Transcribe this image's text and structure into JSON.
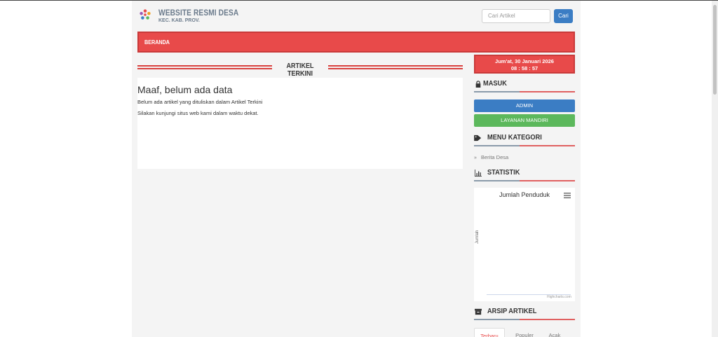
{
  "header": {
    "site_title": "WEBSITE RESMI DESA",
    "site_subtitle": "KEC. KAB. PROV.",
    "search_placeholder": "Cari Artikel",
    "search_button": "Cari"
  },
  "nav": {
    "items": [
      {
        "label": "BERANDA"
      }
    ]
  },
  "main": {
    "section_title": "ARTIKEL TERKINI",
    "nodata_title": "Maaf, belum ada data",
    "nodata_line1": "Belum ada artikel yang dituliskan dalam Artikel Terkini",
    "nodata_line2": "Silakan kunjungi situs web kami dalam waktu dekat."
  },
  "sidebar": {
    "date": "Jum'at, 30 Januari 2026",
    "time": "08 : 58 : 57",
    "login_title": "MASUK",
    "admin_button": "ADMIN",
    "layanan_button": "LAYANAN MANDIRI",
    "category_title": "MENU KATEGORI",
    "categories": [
      {
        "label": "Berita Desa"
      }
    ],
    "stats_title": "STATISTIK",
    "chart_title": "Jumlah Penduduk",
    "chart_ylabel": "Jumlah",
    "chart_credit": "Highcharts.com",
    "archive_title": "ARSIP ARTIKEL",
    "archive_tabs": [
      {
        "label": "Terbaru"
      },
      {
        "label": "Populer"
      },
      {
        "label": "Acak"
      }
    ]
  },
  "colors": {
    "accent_red": "#e84a4a",
    "primary_blue": "#3b7dc4",
    "success_green": "#5cb85c"
  }
}
